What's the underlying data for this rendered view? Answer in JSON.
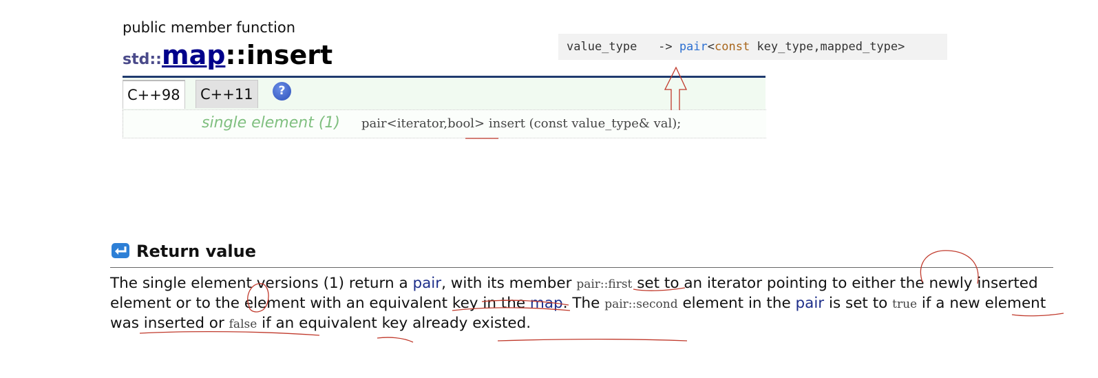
{
  "header": {
    "kind": "public member function",
    "ns": "std::",
    "cls": "map",
    "sep": "::",
    "method": "insert"
  },
  "tabs": [
    "C++98",
    "C++11"
  ],
  "help_symbol": "?",
  "prototype": {
    "label": "single element (1)",
    "code": "pair<iterator,bool> insert (const value_type& val);"
  },
  "value_type_note": {
    "lhs": "value_type",
    "arrow": "->",
    "pair": "pair",
    "lt": "<",
    "const": "const",
    "rest": " key_type,mapped_type>"
  },
  "return_value": {
    "heading": "Return value",
    "p1": "The single element versions (1) return a ",
    "pair1": "pair",
    "p2": ", with its member ",
    "code_first": "pair::first",
    "p3": " set to an iterator pointing to either the newly inserted element or to the element with an equivalent key in the ",
    "map": "map",
    "p4": ". The ",
    "code_second": "pair::second",
    "p5": " element in the ",
    "pair2": "pair",
    "p6": " is set to ",
    "code_true": "true",
    "p7": " if a new element was inserted or ",
    "code_false": "false",
    "p8": " if an equivalent key already existed."
  },
  "colors": {
    "link": "#00008b",
    "header_rule": "#1f3a6e",
    "proto_label": "#7fbf7f",
    "annotation_ink": "#c0392b"
  }
}
